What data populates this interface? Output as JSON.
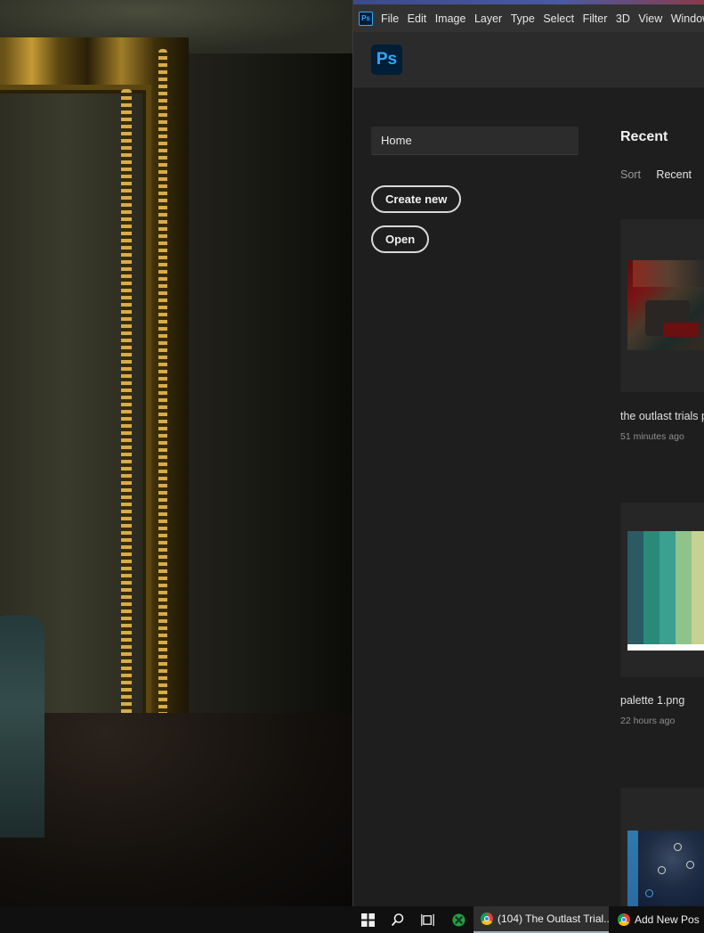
{
  "menubar": {
    "app_icon": "ps-icon",
    "items": [
      "File",
      "Edit",
      "Image",
      "Layer",
      "Type",
      "Select",
      "Filter",
      "3D",
      "View",
      "Window"
    ]
  },
  "header": {
    "logo_text": "Ps"
  },
  "sidebar": {
    "home_label": "Home",
    "create_new_label": "Create new",
    "open_label": "Open"
  },
  "main": {
    "recent_heading": "Recent",
    "sort_label": "Sort",
    "sort_value": "Recent",
    "files": [
      {
        "name": "the outlast trials p",
        "time": "51 minutes ago"
      },
      {
        "name": "palette 1.png",
        "time": "22 hours ago"
      },
      {
        "name": "",
        "time": ""
      }
    ],
    "palette_colors": [
      "#2a5a62",
      "#2a8a7a",
      "#3aa090",
      "#8ec48a",
      "#c8d290"
    ]
  },
  "taskbar": {
    "start_icon": "windows-start-icon",
    "search_icon": "search-icon",
    "taskview_icon": "task-view-icon",
    "xbox_icon": "xbox-icon",
    "tasks": [
      {
        "label": "(104) The Outlast Trial...",
        "icon": "chrome-icon"
      },
      {
        "label": "Add New Post",
        "icon": "chrome-icon"
      }
    ]
  },
  "colors": {
    "ps_blue": "#31a8ff",
    "ps_dark": "#001e36",
    "window_bg": "#1e1e1e",
    "menubar_bg": "#323232"
  }
}
